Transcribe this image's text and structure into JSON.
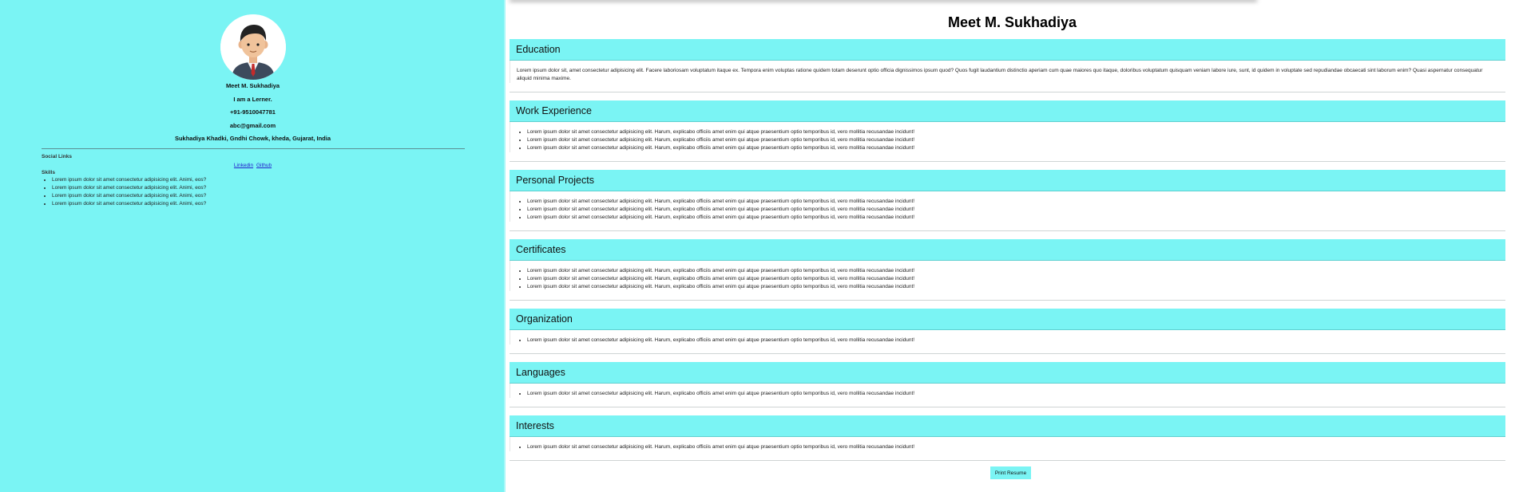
{
  "profile": {
    "name": "Meet M. Sukhadiya",
    "tagline": "I am a Lerner.",
    "phone": "+91-9510047781",
    "email": "abc@gmail.com",
    "address": "Sukhadiya Khadki, Gndhi Chowk, kheda, Gujarat, India"
  },
  "sidebar": {
    "social_heading": "Social Links",
    "links": {
      "linkedin": "Linkedin",
      "github": "Github"
    },
    "skills_heading": "Skills",
    "skills": [
      "Lorem ipsum dolor sit amet consectetur adipisicing elit. Animi, eos?",
      "Lorem ipsum dolor sit amet consectetur adipisicing elit. Animi, eos?",
      "Lorem ipsum dolor sit amet consectetur adipisicing elit. Animi, eos?",
      "Lorem ipsum dolor sit amet consectetur adipisicing elit. Animi, eos?"
    ]
  },
  "main": {
    "title": "Meet M. Sukhadiya",
    "education": {
      "heading": "Education",
      "text": "Lorem ipsum dolor sit, amet consectetur adipisicing elit. Facere laboriosam voluptatum itaque ex. Tempora enim voluptas ratione quidem totam deserunt optio officia dignissimos ipsum quod? Quos fugit laudantium distinctio aperiam cum quae maiores quo itaque, doloribus voluptatum quisquam veniam labore iure, sunt, id quidem in voluptate sed repudiandae obcaecati sint laborum enim? Quasi aspernatur consequatur aliquid minima maxime."
    },
    "work": {
      "heading": "Work Experience",
      "items": [
        "Lorem ipsum dolor sit amet consectetur adipisicing elit. Harum, explicabo officiis amet enim qui atque praesentium optio temporibus id, vero mollitia recusandae incidunt!",
        "Lorem ipsum dolor sit amet consectetur adipisicing elit. Harum, explicabo officiis amet enim qui atque praesentium optio temporibus id, vero mollitia recusandae incidunt!",
        "Lorem ipsum dolor sit amet consectetur adipisicing elit. Harum, explicabo officiis amet enim qui atque praesentium optio temporibus id, vero mollitia recusandae incidunt!"
      ]
    },
    "projects": {
      "heading": "Personal Projects",
      "items": [
        "Lorem ipsum dolor sit amet consectetur adipisicing elit. Harum, explicabo officiis amet enim qui atque praesentium optio temporibus id, vero mollitia recusandae incidunt!",
        "Lorem ipsum dolor sit amet consectetur adipisicing elit. Harum, explicabo officiis amet enim qui atque praesentium optio temporibus id, vero mollitia recusandae incidunt!",
        "Lorem ipsum dolor sit amet consectetur adipisicing elit. Harum, explicabo officiis amet enim qui atque praesentium optio temporibus id, vero mollitia recusandae incidunt!"
      ]
    },
    "certificates": {
      "heading": "Certificates",
      "items": [
        "Lorem ipsum dolor sit amet consectetur adipisicing elit. Harum, explicabo officiis amet enim qui atque praesentium optio temporibus id, vero mollitia recusandae incidunt!",
        "Lorem ipsum dolor sit amet consectetur adipisicing elit. Harum, explicabo officiis amet enim qui atque praesentium optio temporibus id, vero mollitia recusandae incidunt!",
        "Lorem ipsum dolor sit amet consectetur adipisicing elit. Harum, explicabo officiis amet enim qui atque praesentium optio temporibus id, vero mollitia recusandae incidunt!"
      ]
    },
    "organization": {
      "heading": "Organization",
      "items": [
        "Lorem ipsum dolor sit amet consectetur adipisicing elit. Harum, explicabo officiis amet enim qui atque praesentium optio temporibus id, vero mollitia recusandae incidunt!"
      ]
    },
    "languages": {
      "heading": "Languages",
      "items": [
        "Lorem ipsum dolor sit amet consectetur adipisicing elit. Harum, explicabo officiis amet enim qui atque praesentium optio temporibus id, vero mollitia recusandae incidunt!"
      ]
    },
    "interests": {
      "heading": "Interests",
      "items": [
        "Lorem ipsum dolor sit amet consectetur adipisicing elit. Harum, explicabo officiis amet enim qui atque praesentium optio temporibus id, vero mollitia recusandae incidunt!"
      ]
    },
    "print_label": "Print Resume"
  },
  "colors": {
    "accent": "#7af4f4",
    "link": "#2222cc"
  },
  "icons": {
    "avatar": "user-avatar-icon"
  }
}
